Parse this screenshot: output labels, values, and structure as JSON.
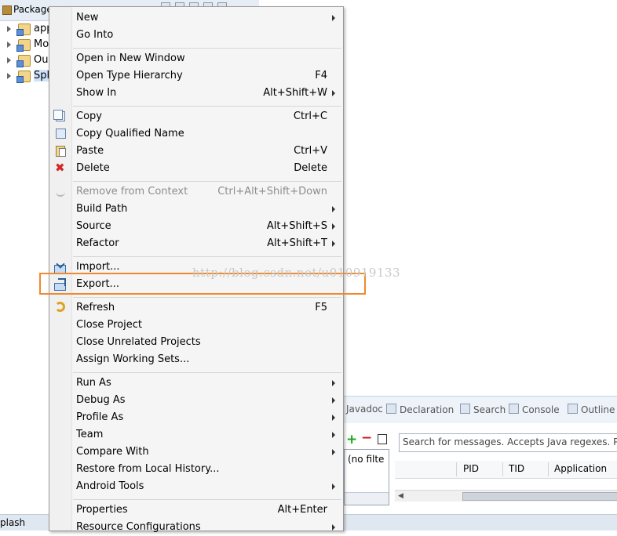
{
  "package_explorer": {
    "tab_title": "Package",
    "items": [
      {
        "label": "app"
      },
      {
        "label": "Mo"
      },
      {
        "label": "Our"
      },
      {
        "label": "Spl"
      }
    ]
  },
  "context_menu": {
    "items": [
      {
        "label": "New",
        "shortcut": "",
        "submenu": true
      },
      {
        "label": "Go Into",
        "shortcut": ""
      },
      {
        "label": "Open in New Window",
        "shortcut": ""
      },
      {
        "label": "Open Type Hierarchy",
        "shortcut": "F4"
      },
      {
        "label": "Show In",
        "shortcut": "Alt+Shift+W",
        "submenu": true
      },
      {
        "label": "Copy",
        "shortcut": "Ctrl+C",
        "icon": "copy-icon"
      },
      {
        "label": "Copy Qualified Name",
        "shortcut": "",
        "icon": "copy-qualified-name-icon"
      },
      {
        "label": "Paste",
        "shortcut": "Ctrl+V",
        "icon": "paste-icon"
      },
      {
        "label": "Delete",
        "shortcut": "Delete",
        "icon": "delete-icon"
      },
      {
        "label": "Remove from Context",
        "shortcut": "Ctrl+Alt+Shift+Down",
        "disabled": true,
        "icon": "remove-context-icon"
      },
      {
        "label": "Build Path",
        "shortcut": "",
        "submenu": true
      },
      {
        "label": "Source",
        "shortcut": "Alt+Shift+S",
        "submenu": true
      },
      {
        "label": "Refactor",
        "shortcut": "Alt+Shift+T",
        "submenu": true
      },
      {
        "label": "Import...",
        "shortcut": "",
        "icon": "import-icon"
      },
      {
        "label": "Export...",
        "shortcut": "",
        "icon": "export-icon"
      },
      {
        "label": "Refresh",
        "shortcut": "F5",
        "icon": "refresh-icon"
      },
      {
        "label": "Close Project",
        "shortcut": ""
      },
      {
        "label": "Close Unrelated Projects",
        "shortcut": ""
      },
      {
        "label": "Assign Working Sets...",
        "shortcut": ""
      },
      {
        "label": "Run As",
        "shortcut": "",
        "submenu": true
      },
      {
        "label": "Debug As",
        "shortcut": "",
        "submenu": true
      },
      {
        "label": "Profile As",
        "shortcut": "",
        "submenu": true
      },
      {
        "label": "Team",
        "shortcut": "",
        "submenu": true
      },
      {
        "label": "Compare With",
        "shortcut": "",
        "submenu": true
      },
      {
        "label": "Restore from Local History...",
        "shortcut": ""
      },
      {
        "label": "Android Tools",
        "shortcut": "",
        "submenu": true
      },
      {
        "label": "Properties",
        "shortcut": "Alt+Enter"
      },
      {
        "label": "Resource Configurations",
        "shortcut": "",
        "submenu": true
      }
    ]
  },
  "views": {
    "tabs": [
      "Javadoc",
      "Declaration",
      "Search",
      "Console",
      "Outline"
    ]
  },
  "logcat": {
    "filter_label": "(no filte",
    "search_placeholder": "Search for messages. Accepts Java regexes. Pre",
    "columns": [
      "PID",
      "TID",
      "Application"
    ]
  },
  "status_bar": {
    "text": "plash"
  },
  "watermark": "http://blog.csdn.net/u010919133",
  "colors": {
    "highlight": "#f0892e",
    "menu_background": "#f5f5f5"
  }
}
